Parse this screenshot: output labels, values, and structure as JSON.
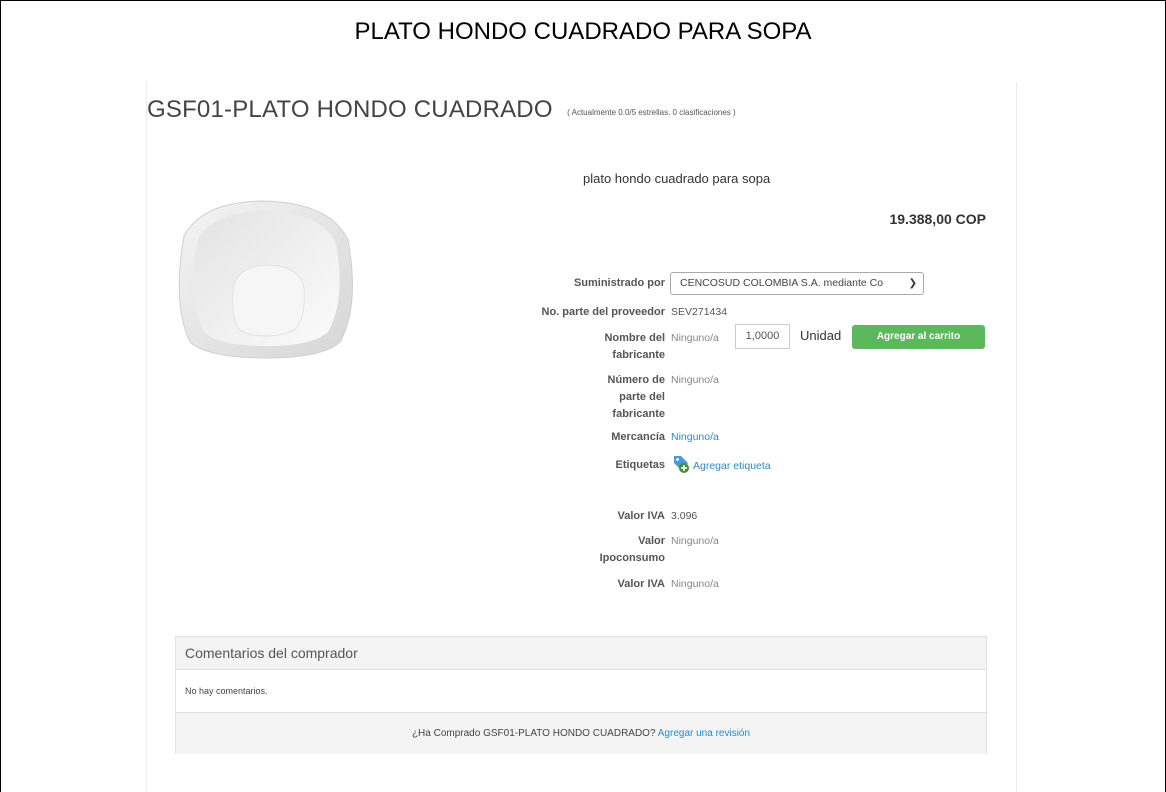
{
  "document": {
    "title": "PLATO HONDO CUADRADO PARA SOPA"
  },
  "product": {
    "title": "GSF01-PLATO HONDO CUADRADO",
    "rating_text": "( Actualmente 0.0/5 estrellas. 0 clasificaciones )",
    "description": "plato hondo cuadrado para sopa",
    "price": "19.388,00 COP",
    "image_icon": "square-bowl-image"
  },
  "order": {
    "quantity": "1,0000",
    "unit": "Unidad",
    "add_to_cart": "Agregar al carrito",
    "add_to_cart_color": "#5cb85c"
  },
  "details": {
    "supplier_label": "Suministrado por",
    "supplier_value": "CENCOSUD COLOMBIA S.A. mediante Co",
    "supplier_part_label": "No. parte del proveedor",
    "supplier_part_value": "SEV271434",
    "manufacturer_label_l1": "Nombre del",
    "manufacturer_label_l2": "fabricante",
    "manufacturer_value": "Ninguno/a",
    "mfr_part_label_l1": "Número de",
    "mfr_part_label_l2": "parte del",
    "mfr_part_label_l3": "fabricante",
    "mfr_part_value": "Ninguno/a",
    "commodity_label": "Mercancía",
    "commodity_value": "Ninguno/a",
    "tags_label": "Etiquetas",
    "tags_link": "Agregar etiqueta",
    "iva_label": "Valor IVA",
    "iva_value": "3.096",
    "ipoconsumo_label_l1": "Valor",
    "ipoconsumo_label_l2": "Ipoconsumo",
    "ipoconsumo_value": "Ninguno/a",
    "iva2_label": "Valor IVA",
    "iva2_value": "Ninguno/a"
  },
  "comments": {
    "heading": "Comentarios del comprador",
    "empty_text": "No hay comentarios.",
    "question": "¿Ha Comprado GSF01-PLATO HONDO CUADRADO?",
    "review_link": "Agregar una revisión"
  },
  "colors": {
    "link": "#2a8bc4",
    "button": "#5cb85c"
  }
}
